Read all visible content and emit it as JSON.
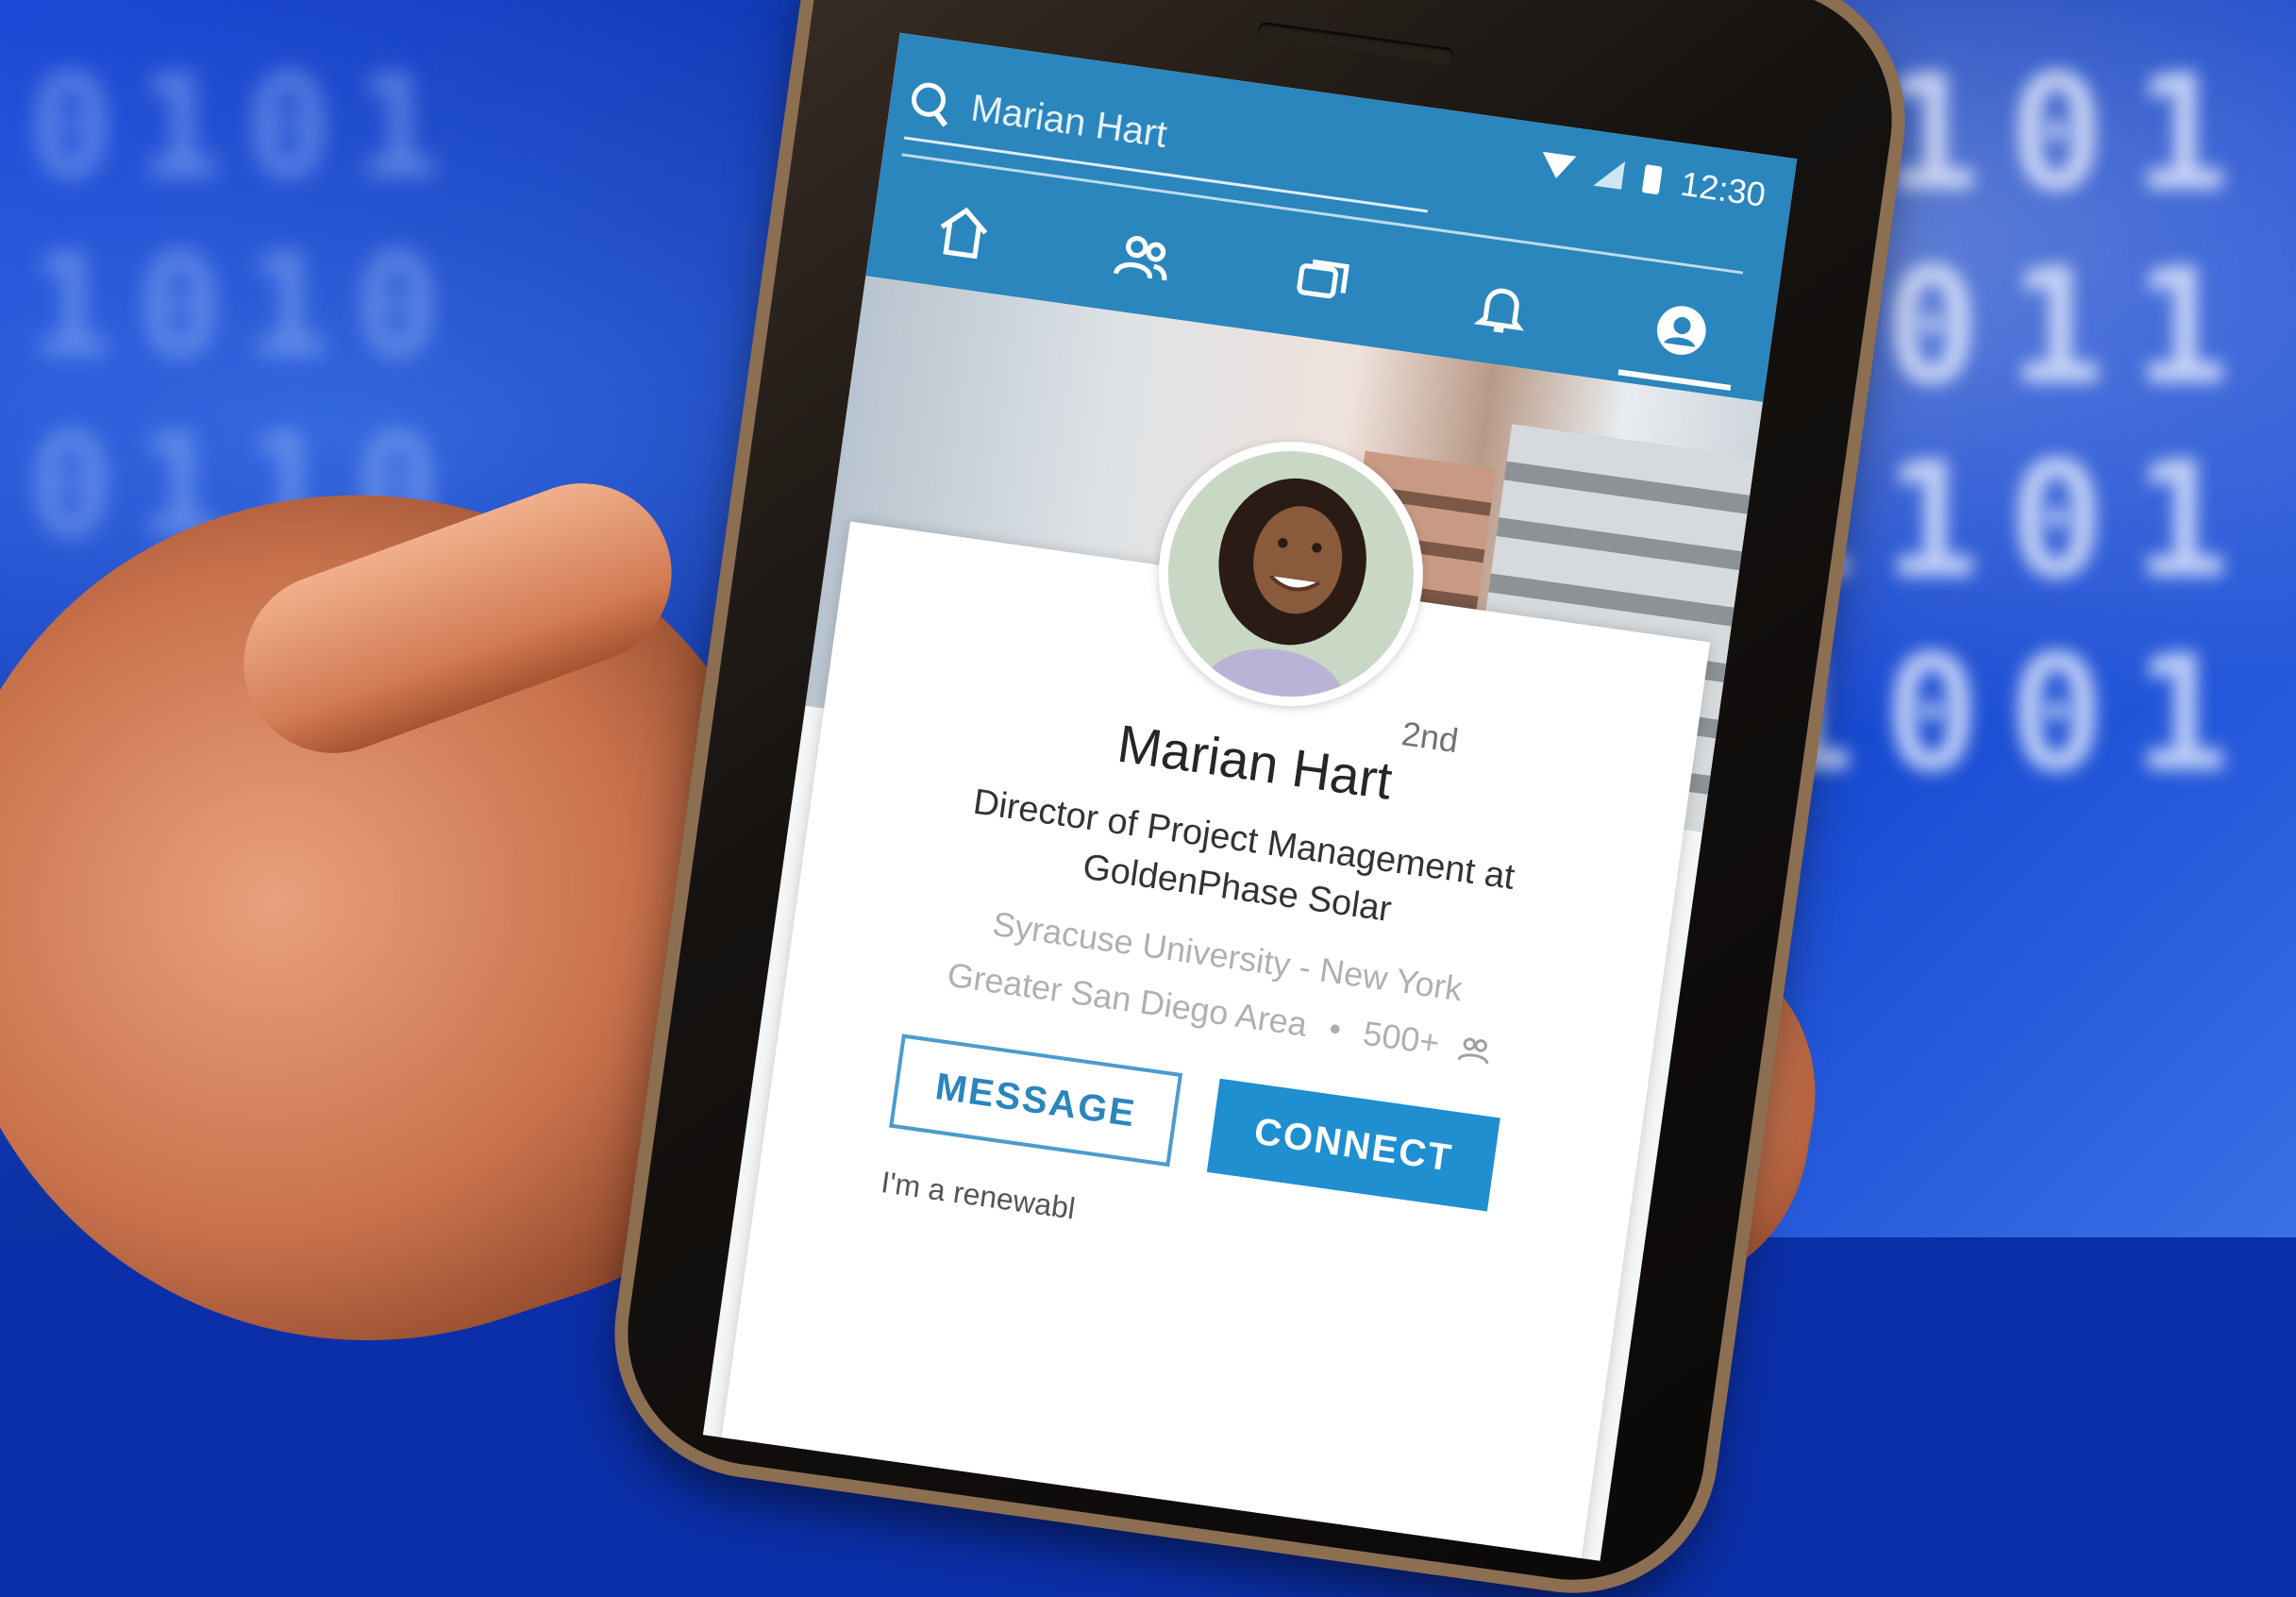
{
  "search": {
    "query": "Marian Hart"
  },
  "status": {
    "time": "12:30"
  },
  "nav": {
    "tabs": [
      {
        "icon": "home-icon"
      },
      {
        "icon": "network-icon"
      },
      {
        "icon": "messages-icon"
      },
      {
        "icon": "notifications-icon"
      },
      {
        "icon": "profile-icon"
      }
    ],
    "active_tab": 4
  },
  "profile": {
    "degree": "2nd",
    "name": "Marian Hart",
    "headline_line1": "Director of Project Management at",
    "headline_line2": "GoldenPhase Solar",
    "education": "Syracuse University - New York",
    "location": "Greater San Diego Area",
    "separator": "•",
    "connections": "500+",
    "summary_snippet": "I'm a renewabl"
  },
  "actions": {
    "message_label": "MESSAGE",
    "connect_label": "CONNECT"
  },
  "background": {
    "digits_right": "1101 1011 1101 1001",
    "digits_left": "0101 1010 0110"
  },
  "colors": {
    "linkedin_blue": "#2a86bd",
    "connect_blue": "#1f8fd0"
  }
}
